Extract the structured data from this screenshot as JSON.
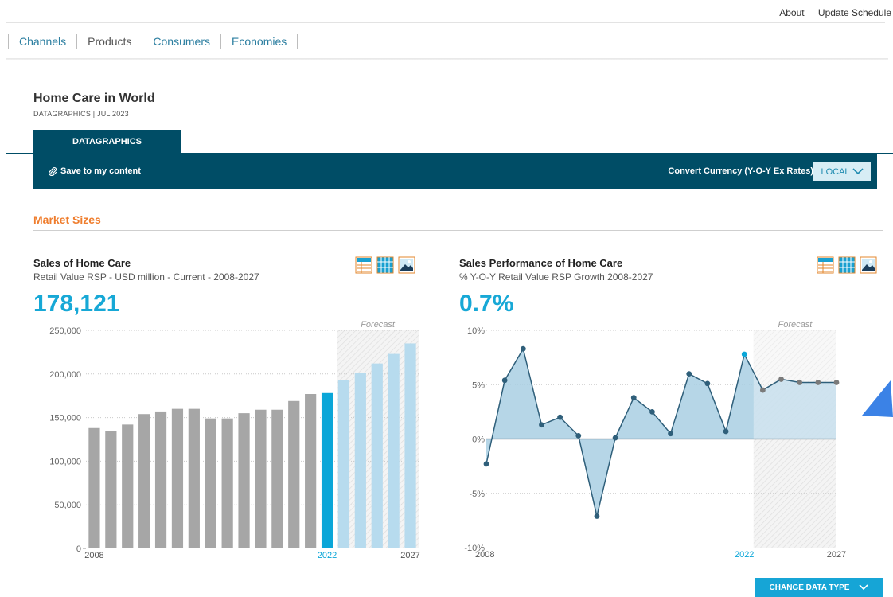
{
  "top_links": [
    "About",
    "Update Schedule"
  ],
  "nav": [
    {
      "label": "Channels",
      "color": "#2b7ea0"
    },
    {
      "label": "Products",
      "color": "#555555"
    },
    {
      "label": "Consumers",
      "color": "#2b7ea0"
    },
    {
      "label": "Economies",
      "color": "#2b7ea0"
    }
  ],
  "page": {
    "title": "Home Care in World",
    "subtitle": "DATAGRAPHICS | JUL 2023"
  },
  "tab": {
    "label": "DATAGRAPHICS"
  },
  "toolbar": {
    "save_label": "Save to my content",
    "convert_label": "Convert Currency (Y-O-Y Ex Rates)",
    "currency": "LOCAL"
  },
  "section": {
    "title": "Market Sizes"
  },
  "charts": {
    "left": {
      "title": "Sales of Home Care",
      "subtitle": "Retail Value RSP - USD million - Current - 2008-2027",
      "headline": "178,121",
      "forecast_label": "Forecast"
    },
    "right": {
      "title": "Sales Performance of Home Care",
      "subtitle": "% Y-O-Y Retail Value RSP Growth 2008-2027",
      "headline": "0.7%",
      "forecast_label": "Forecast"
    }
  },
  "buttons": {
    "change_data_type": "CHANGE DATA TYPE"
  },
  "colors": {
    "accent": "#17a8d6",
    "toolbar": "#004d66",
    "orange": "#ef7d2d",
    "bar_history": "#a6a6a6",
    "bar_current": "#0aa6d8",
    "bar_forecast": "#b7dbee",
    "line": "#2f5f7a",
    "area": "#a9cfe3"
  },
  "chart_data": [
    {
      "type": "bar",
      "categories": [
        "2008",
        "2009",
        "2010",
        "2011",
        "2012",
        "2013",
        "2014",
        "2015",
        "2016",
        "2017",
        "2018",
        "2019",
        "2020",
        "2021",
        "2022",
        "2023",
        "2024",
        "2025",
        "2026",
        "2027"
      ],
      "values": [
        138000,
        135000,
        142000,
        154000,
        157000,
        160000,
        160000,
        149000,
        149000,
        155000,
        159000,
        159000,
        169000,
        177000,
        178121,
        193000,
        201000,
        212000,
        223000,
        235000
      ],
      "x_tick_labels": [
        "2008",
        "2022",
        "2027"
      ],
      "y_ticks": [
        "0",
        "50,000",
        "100,000",
        "150,000",
        "200,000",
        "250,000"
      ],
      "ylim": [
        0,
        250000
      ],
      "current_year": "2022",
      "forecast_from": "2023",
      "grid": true
    },
    {
      "type": "area",
      "x": [
        "2008",
        "2009",
        "2010",
        "2011",
        "2012",
        "2013",
        "2014",
        "2015",
        "2016",
        "2017",
        "2018",
        "2019",
        "2020",
        "2021",
        "2022",
        "2023",
        "2024",
        "2025",
        "2026",
        "2027"
      ],
      "values": [
        -2.3,
        5.4,
        8.3,
        1.3,
        2.0,
        0.3,
        -7.1,
        0.1,
        3.8,
        2.5,
        0.5,
        6.0,
        5.1,
        0.7,
        7.8,
        4.5,
        5.5,
        5.2,
        5.2,
        5.2
      ],
      "x_tick_labels": [
        "2008",
        "2022",
        "2027"
      ],
      "y_ticks": [
        "-10%",
        "-5%",
        "0%",
        "5%",
        "10%"
      ],
      "ylim": [
        -10,
        10
      ],
      "current_year": "2022",
      "forecast_from": "2023",
      "grid": true
    }
  ]
}
